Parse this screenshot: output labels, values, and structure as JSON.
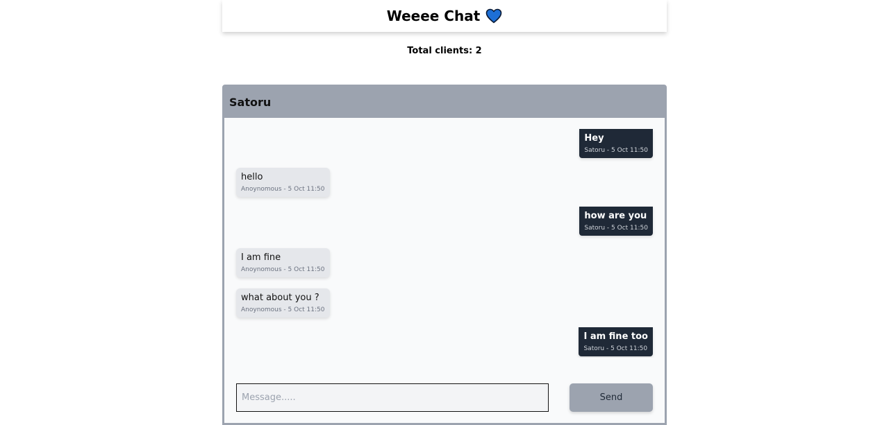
{
  "header": {
    "title": "Weeee Chat",
    "icon": "blue-heart-icon",
    "icon_color": "#1d6fd6"
  },
  "status": {
    "total_clients": "Total clients: 2"
  },
  "chat": {
    "name": "Satoru",
    "messages": [
      {
        "direction": "sent",
        "text": "Hey",
        "meta": "Satoru - 5 Oct 11:50"
      },
      {
        "direction": "received",
        "text": "hello",
        "meta": "Anoynomous - 5 Oct 11:50"
      },
      {
        "direction": "sent",
        "text": "how are you",
        "meta": "Satoru - 5 Oct 11:50"
      },
      {
        "direction": "received",
        "text": "I am fine",
        "meta": "Anoynomous - 5 Oct 11:50"
      },
      {
        "direction": "received",
        "text": "what about you ?",
        "meta": "Anoynomous - 5 Oct 11:50"
      },
      {
        "direction": "sent",
        "text": "I am fine too",
        "meta": "Satoru - 5 Oct 11:50"
      }
    ]
  },
  "composer": {
    "placeholder": "Message.....",
    "value": "",
    "send_label": "Send"
  },
  "colors": {
    "sent_bubble": "#1f2937",
    "received_bubble": "#e5e7eb",
    "chat_header": "#9ca3af"
  }
}
